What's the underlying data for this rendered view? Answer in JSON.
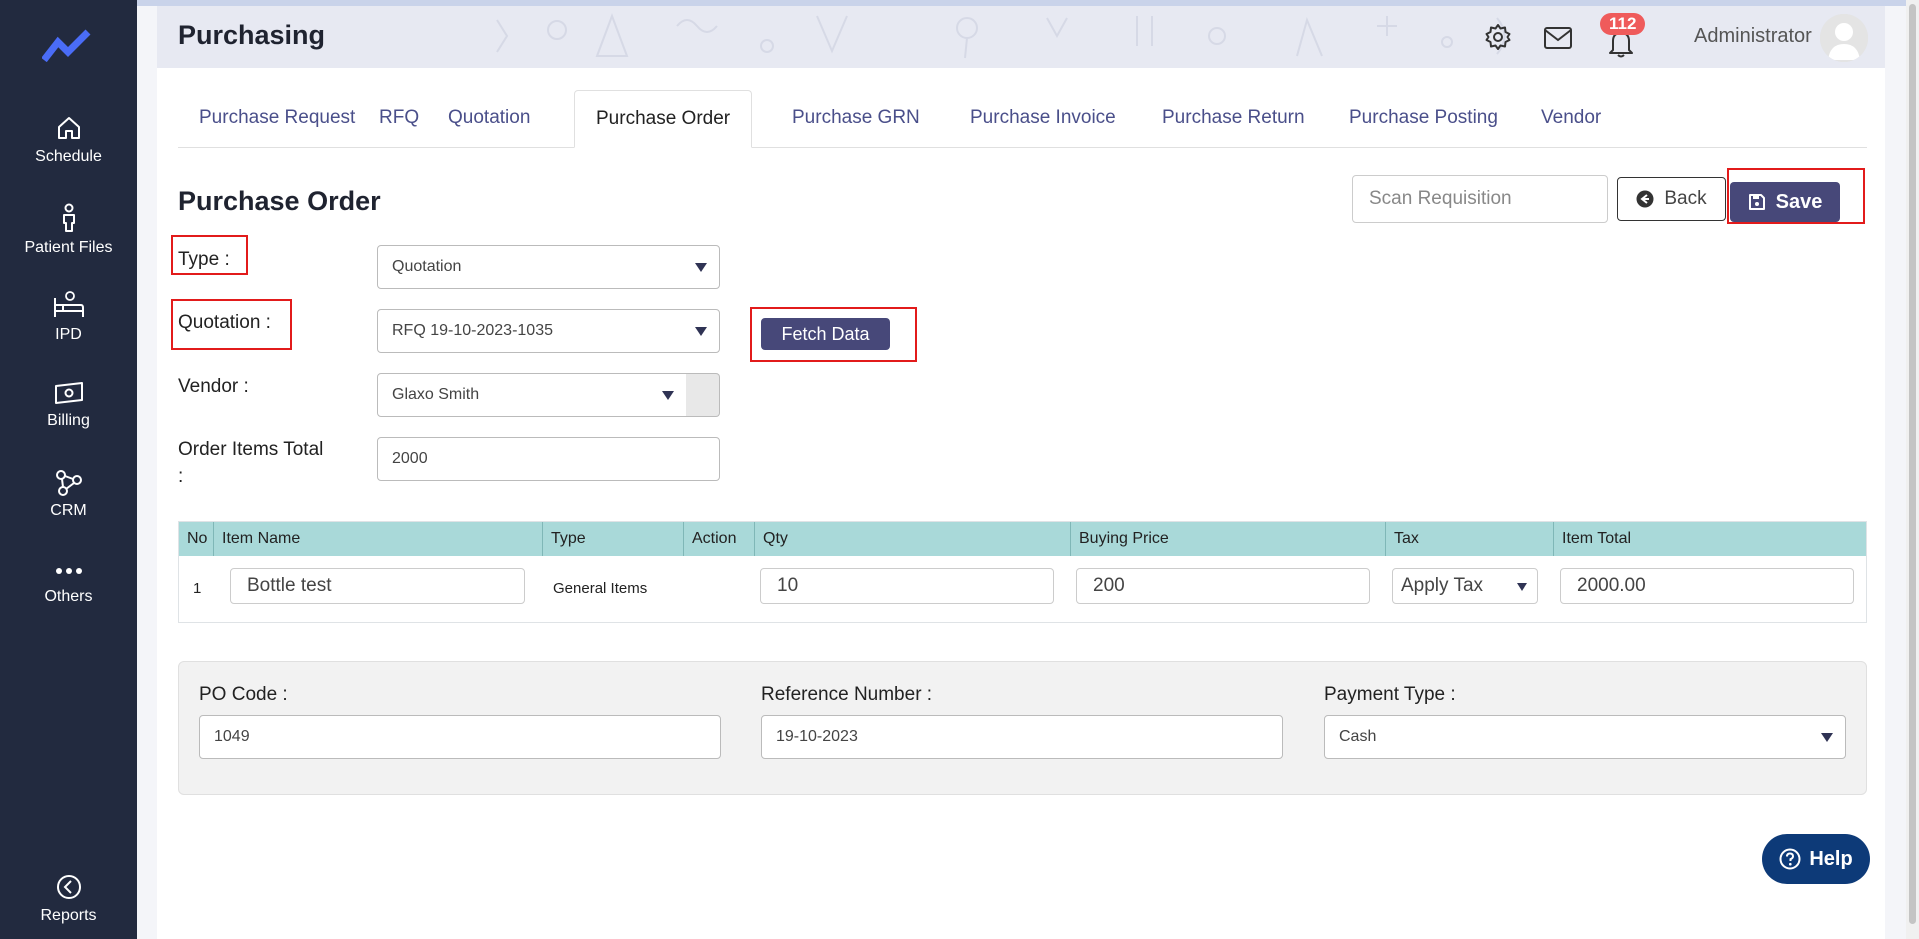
{
  "app": {
    "title": "Purchasing"
  },
  "sidebar": {
    "items": [
      {
        "label": "Schedule",
        "icon": "home-icon"
      },
      {
        "label": "Patient Files",
        "icon": "person-icon"
      },
      {
        "label": "IPD",
        "icon": "bed-icon"
      },
      {
        "label": "Billing",
        "icon": "money-icon"
      },
      {
        "label": "CRM",
        "icon": "network-icon"
      },
      {
        "label": "Others",
        "icon": "more-icon"
      },
      {
        "label": "Reports",
        "icon": "reports-icon"
      }
    ]
  },
  "header": {
    "notification_count": "112",
    "user_name": "Administrator"
  },
  "tabs": [
    {
      "label": "Purchase Request"
    },
    {
      "label": "RFQ"
    },
    {
      "label": "Quotation"
    },
    {
      "label": "Purchase Order",
      "active": true
    },
    {
      "label": "Purchase GRN"
    },
    {
      "label": "Purchase Invoice"
    },
    {
      "label": "Purchase Return"
    },
    {
      "label": "Purchase Posting"
    },
    {
      "label": "Vendor"
    }
  ],
  "form": {
    "section_title": "Purchase Order",
    "scan_placeholder": "Scan Requisition",
    "back_label": "Back",
    "save_label": "Save",
    "type_label": "Type :",
    "type_value": "Quotation",
    "quotation_label": "Quotation :",
    "quotation_value": "RFQ 19-10-2023-1035",
    "fetch_label": "Fetch Data",
    "vendor_label": "Vendor :",
    "vendor_value": "Glaxo Smith",
    "order_total_label_1": "Order Items Total",
    "order_total_label_2": ":",
    "order_total_value": "2000"
  },
  "table": {
    "headers": [
      "No",
      "Item Name",
      "Type",
      "Action",
      "Qty",
      "Buying Price",
      "Tax",
      "Item Total"
    ],
    "rows": [
      {
        "no": "1",
        "item_name": "Bottle test",
        "type": "General Items",
        "qty": "10",
        "buying_price": "200",
        "tax": "Apply Tax",
        "item_total": "2000.00"
      }
    ]
  },
  "details": {
    "po_code_label": "PO Code :",
    "po_code_value": "1049",
    "reference_label": "Reference Number :",
    "reference_value": "19-10-2023",
    "payment_label": "Payment Type :",
    "payment_value": "Cash"
  },
  "help_label": "Help",
  "colors": {
    "sidebar": "#222a3f",
    "primary_button": "#474879",
    "table_header": "#a9d9d9",
    "highlight": "#e21b1b",
    "badge": "#ef5b5b",
    "help": "#0d3a78"
  }
}
